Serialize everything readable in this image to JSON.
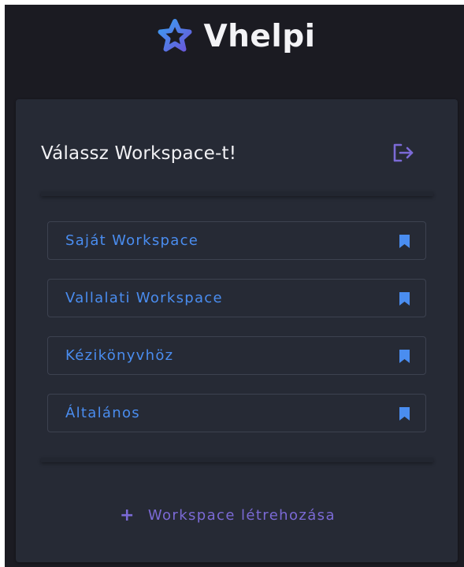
{
  "app": {
    "brand": "Vhelpi",
    "logo_icon": "star-icon",
    "accent_color": "#7b6ad6",
    "link_color": "#4a8df0"
  },
  "panel": {
    "title": "Válassz Workspace-t!",
    "logout_icon": "logout-icon"
  },
  "workspaces": [
    {
      "label": "Saját Workspace",
      "icon": "bookmark-icon"
    },
    {
      "label": "Vallalati Workspace",
      "icon": "bookmark-icon"
    },
    {
      "label": "Kézikönyvhöz",
      "icon": "bookmark-icon"
    },
    {
      "label": "Általános",
      "icon": "bookmark-icon"
    }
  ],
  "create": {
    "plus": "+",
    "label": "Workspace létrehozása"
  }
}
